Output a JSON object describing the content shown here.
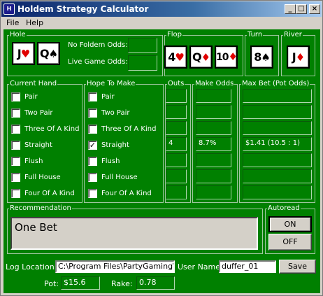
{
  "window": {
    "title": "Holdem Strategy Calculator",
    "icon": "app-icon",
    "icon_glyph": "H",
    "controls": {
      "minimize": "_",
      "maximize": "□",
      "close": "×"
    }
  },
  "menu": {
    "file": "File",
    "help": "Help"
  },
  "hole": {
    "legend": "Hole",
    "cards": [
      {
        "rank": "J",
        "suit": "♥",
        "color": "#e00000"
      },
      {
        "rank": "Q",
        "suit": "♠",
        "color": "#000000"
      }
    ],
    "no_foldem_label": "No Foldem Odds:",
    "no_foldem_value": "",
    "live_game_label": "Live Game Odds:",
    "live_game_value": ""
  },
  "flop": {
    "legend": "Flop",
    "cards": [
      {
        "rank": "4",
        "suit": "♥",
        "color": "#e00000"
      },
      {
        "rank": "Q",
        "suit": "♦",
        "color": "#e00000"
      },
      {
        "rank": "10",
        "suit": "♦",
        "color": "#e00000"
      }
    ]
  },
  "turn": {
    "legend": "Turn",
    "card": {
      "rank": "8",
      "suit": "♠",
      "color": "#000000"
    }
  },
  "river": {
    "legend": "River",
    "card": {
      "rank": "J",
      "suit": "♦",
      "color": "#e00000"
    }
  },
  "current_hand": {
    "legend": "Current Hand",
    "items": [
      {
        "label": "Pair",
        "checked": false
      },
      {
        "label": "Two Pair",
        "checked": false
      },
      {
        "label": "Three Of A Kind",
        "checked": false
      },
      {
        "label": "Straight",
        "checked": false
      },
      {
        "label": "Flush",
        "checked": false
      },
      {
        "label": "Full House",
        "checked": false
      },
      {
        "label": "Four Of A Kind",
        "checked": false
      }
    ]
  },
  "hope_to_make": {
    "legend": "Hope To Make",
    "items": [
      {
        "label": "Pair",
        "checked": false
      },
      {
        "label": "Two Pair",
        "checked": false
      },
      {
        "label": "Three Of A Kind",
        "checked": false
      },
      {
        "label": "Straight",
        "checked": true
      },
      {
        "label": "Flush",
        "checked": false
      },
      {
        "label": "Full House",
        "checked": false
      },
      {
        "label": "Four Of A Kind",
        "checked": false
      }
    ]
  },
  "outs": {
    "legend": "Outs",
    "values": [
      "",
      "",
      "",
      "4",
      "",
      "",
      ""
    ]
  },
  "make_odds": {
    "legend": "Make Odds",
    "values": [
      "",
      "",
      "",
      "8.7%",
      "",
      "",
      ""
    ]
  },
  "max_bet": {
    "legend": "Max Bet (Pot Odds)",
    "values": [
      "",
      "",
      "",
      "$1.41 (10.5 : 1)",
      "",
      "",
      ""
    ]
  },
  "recommendation": {
    "legend": "Recommendation",
    "text": "One Bet"
  },
  "autoread": {
    "legend": "Autoread",
    "on_label": "ON",
    "off_label": "OFF",
    "selected": "ON"
  },
  "bottom": {
    "log_location_label": "Log Location:",
    "log_location_value": "C:\\Program Files\\PartyGaming\\",
    "user_name_label": "User Name:",
    "user_name_value": "duffer_01",
    "save_label": "Save",
    "pot_label": "Pot:",
    "pot_value": "$15.6",
    "rake_label": "Rake:",
    "rake_value": "0.78"
  }
}
